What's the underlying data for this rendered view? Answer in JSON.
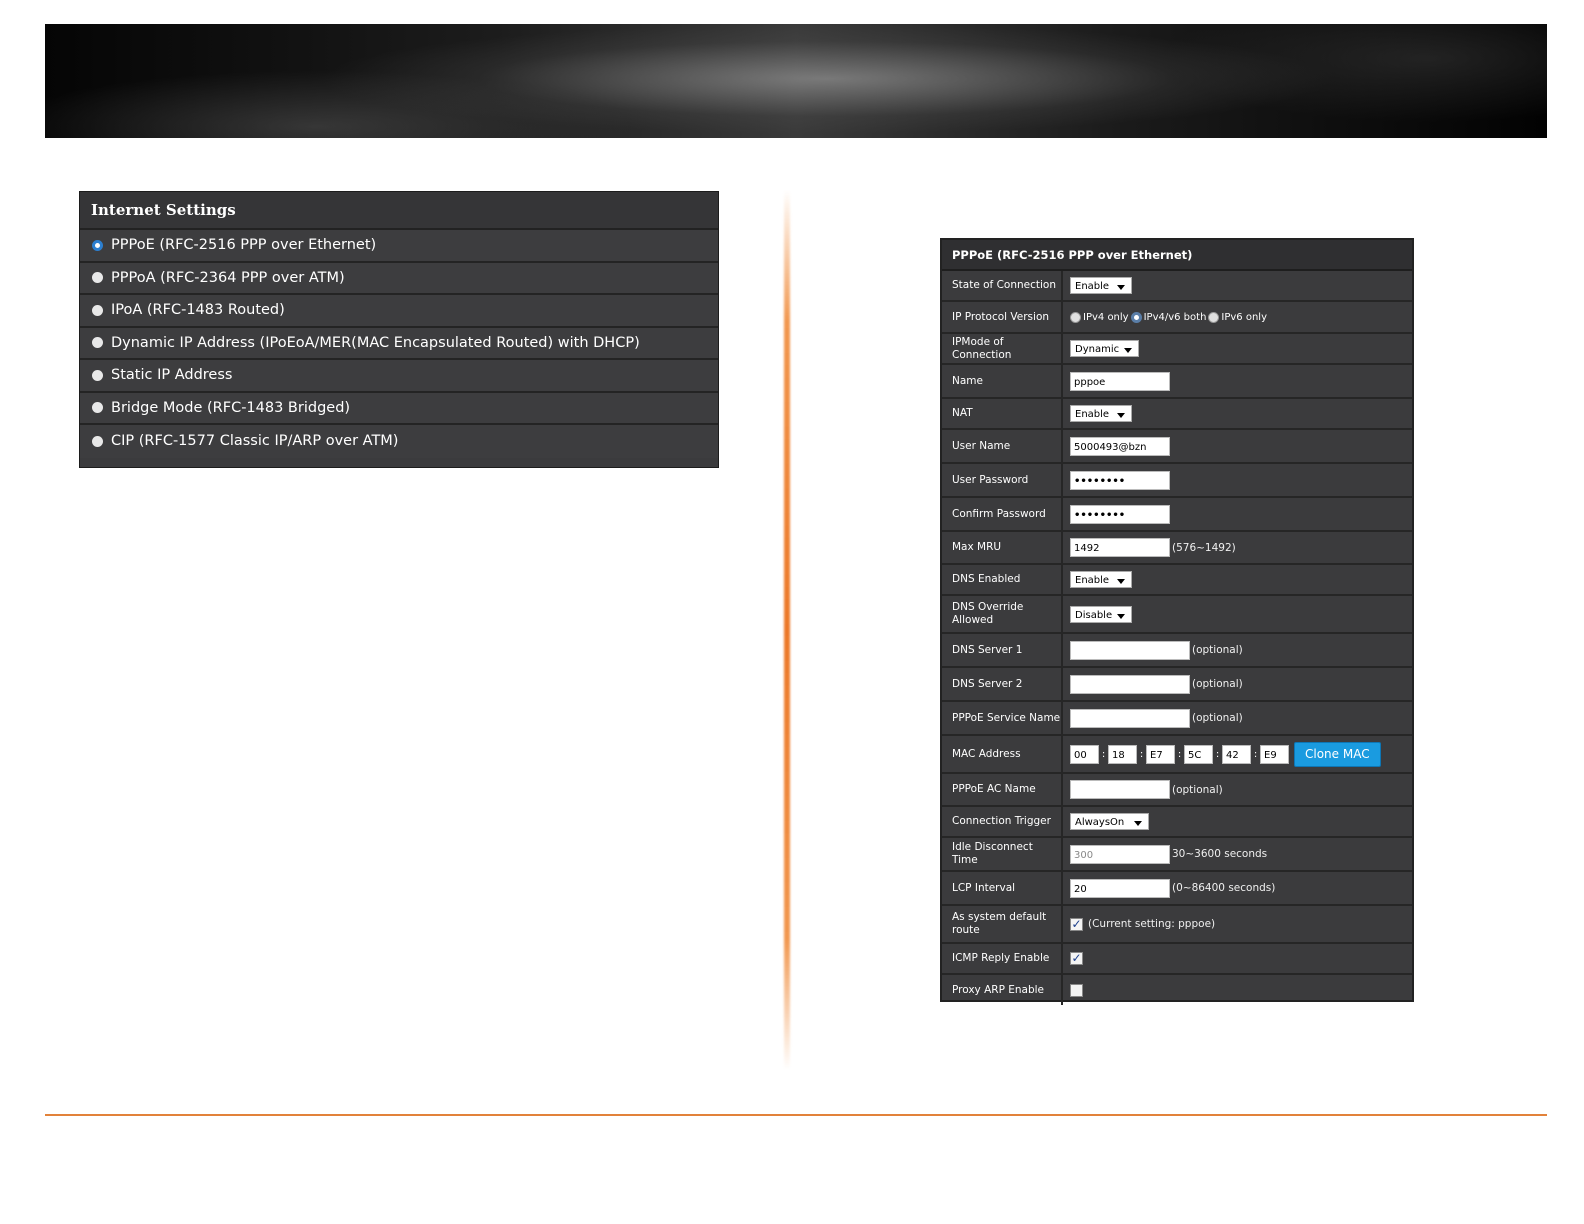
{
  "internet_settings": {
    "title": "Internet Settings",
    "options": [
      {
        "label": "PPPoE (RFC-2516 PPP over Ethernet)",
        "selected": true
      },
      {
        "label": "PPPoA (RFC-2364 PPP over ATM)",
        "selected": false
      },
      {
        "label": "IPoA (RFC-1483 Routed)",
        "selected": false
      },
      {
        "label": "Dynamic IP Address (IPoEoA/MER(MAC Encapsulated Routed) with DHCP)",
        "selected": false
      },
      {
        "label": "Static IP Address",
        "selected": false
      },
      {
        "label": "Bridge Mode (RFC-1483 Bridged)",
        "selected": false
      },
      {
        "label": "CIP (RFC-1577 Classic IP/ARP over ATM)",
        "selected": false
      }
    ]
  },
  "pppoe_form": {
    "title": "PPPoE (RFC-2516 PPP over Ethernet)",
    "state_of_connection": {
      "label": "State of Connection",
      "value": "Enable"
    },
    "ip_protocol_version": {
      "label": "IP Protocol Version",
      "options": [
        "IPv4 only",
        "IPv4/v6 both",
        "IPv6 only"
      ],
      "selected": "IPv4/v6 both"
    },
    "ipmode_of_connection": {
      "label": "IPMode of Connection",
      "value": "Dynamic"
    },
    "name": {
      "label": "Name",
      "value": "pppoe"
    },
    "nat": {
      "label": "NAT",
      "value": "Enable"
    },
    "user_name": {
      "label": "User Name",
      "value": "5000493@bzn"
    },
    "user_password": {
      "label": "User Password",
      "value": "••••••••"
    },
    "confirm_password": {
      "label": "Confirm Password",
      "value": "••••••••"
    },
    "max_mru": {
      "label": "Max MRU",
      "value": "1492",
      "hint": "(576~1492)"
    },
    "dns_enabled": {
      "label": "DNS Enabled",
      "value": "Enable"
    },
    "dns_override": {
      "label": "DNS Override Allowed",
      "value": "Disable"
    },
    "dns_server_1": {
      "label": "DNS Server 1",
      "value": "",
      "hint": "(optional)"
    },
    "dns_server_2": {
      "label": "DNS Server 2",
      "value": "",
      "hint": "(optional)"
    },
    "pppoe_service_name": {
      "label": "PPPoE Service Name",
      "value": "",
      "hint": "(optional)"
    },
    "mac_address": {
      "label": "MAC Address",
      "octets": [
        "00",
        "18",
        "E7",
        "5C",
        "42",
        "E9"
      ],
      "separator": ":",
      "clone_button": "Clone MAC"
    },
    "pppoe_ac_name": {
      "label": "PPPoE AC Name",
      "value": "",
      "hint": "(optional)"
    },
    "connection_trigger": {
      "label": "Connection Trigger",
      "value": "AlwaysOn"
    },
    "idle_disconnect_time": {
      "label": "Idle Disconnect Time",
      "value": "300",
      "hint": "30~3600 seconds"
    },
    "lcp_interval": {
      "label": "LCP Interval",
      "value": "20",
      "hint": "(0~86400 seconds)"
    },
    "system_default_route": {
      "label": "As system default route",
      "checked": true,
      "hint": "(Current setting: pppoe)"
    },
    "icmp_reply_enable": {
      "label": "ICMP Reply Enable",
      "checked": true
    },
    "proxy_arp_enable": {
      "label": "Proxy ARP Enable",
      "checked": false
    }
  },
  "colors": {
    "panel_bg": "#3b3b3d",
    "accent_orange": "#e2823a",
    "button_blue": "#1a9be0",
    "radio_selected": "#2c7fd0"
  }
}
